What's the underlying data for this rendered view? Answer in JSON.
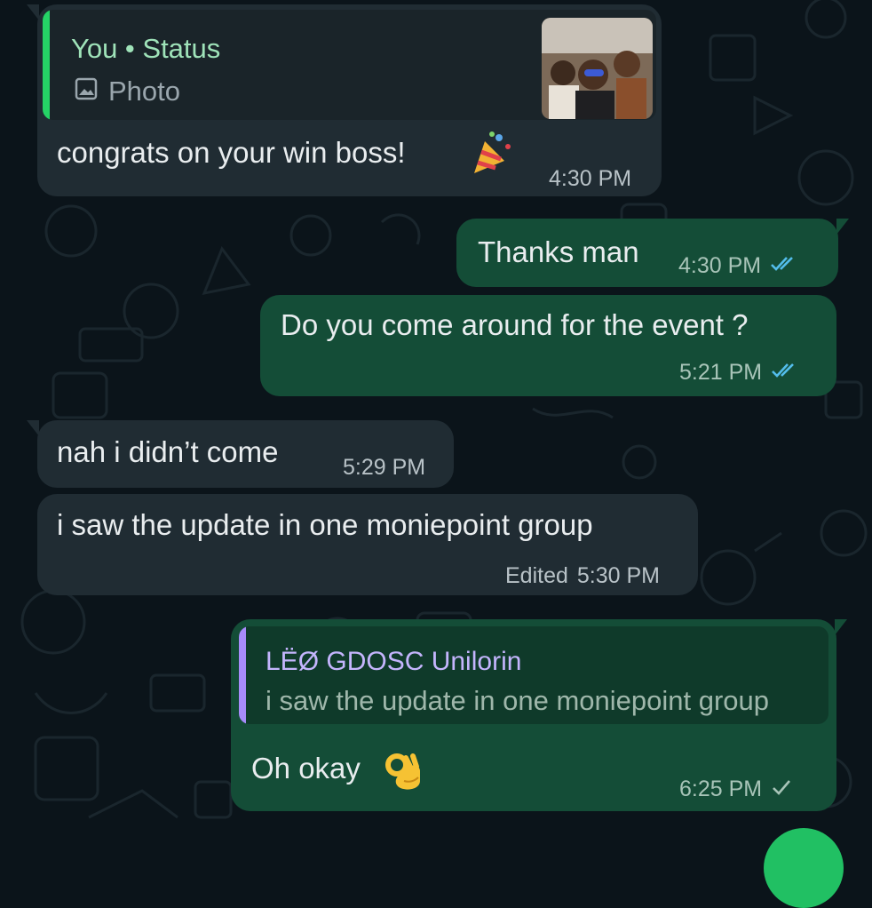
{
  "messages": [
    {
      "id": "m1",
      "direction": "incoming",
      "reply": {
        "author": "You • Status",
        "type_label": "Photo",
        "thumbnail": "photo-thumbnail"
      },
      "text": "congrats on your win boss!",
      "emoji": "party-popper",
      "time": "4:30 PM"
    },
    {
      "id": "m2",
      "direction": "outgoing",
      "text": "Thanks man",
      "time": "4:30 PM",
      "status": "read-double-check"
    },
    {
      "id": "m3",
      "direction": "outgoing",
      "text": "Do you come around for the event ?",
      "time": "5:21 PM",
      "status": "read-double-check"
    },
    {
      "id": "m4",
      "direction": "incoming",
      "text": "nah i didn’t come",
      "time": "5:29 PM"
    },
    {
      "id": "m5",
      "direction": "incoming",
      "text": "i saw the update in one moniepoint group",
      "edited": "Edited",
      "time": "5:30 PM"
    },
    {
      "id": "m6",
      "direction": "outgoing",
      "reply": {
        "author": "LËØ GDOSC Unilorin",
        "text": "i saw the update in one moniepoint group"
      },
      "text": "Oh okay",
      "emoji": "ok-hand",
      "time": "6:25 PM",
      "status": "sent-single-check"
    }
  ],
  "colors": {
    "background": "#0b141a",
    "incoming_bubble": "#202c33",
    "outgoing_bubble": "#144d37",
    "status_reply_accent": "#25d366",
    "status_reply_author": "#9fe3b9",
    "contact_reply_accent": "#a78bfa",
    "contact_reply_author": "#c4b5fd",
    "read_tick": "#53bdeb",
    "fab": "#21c063"
  }
}
